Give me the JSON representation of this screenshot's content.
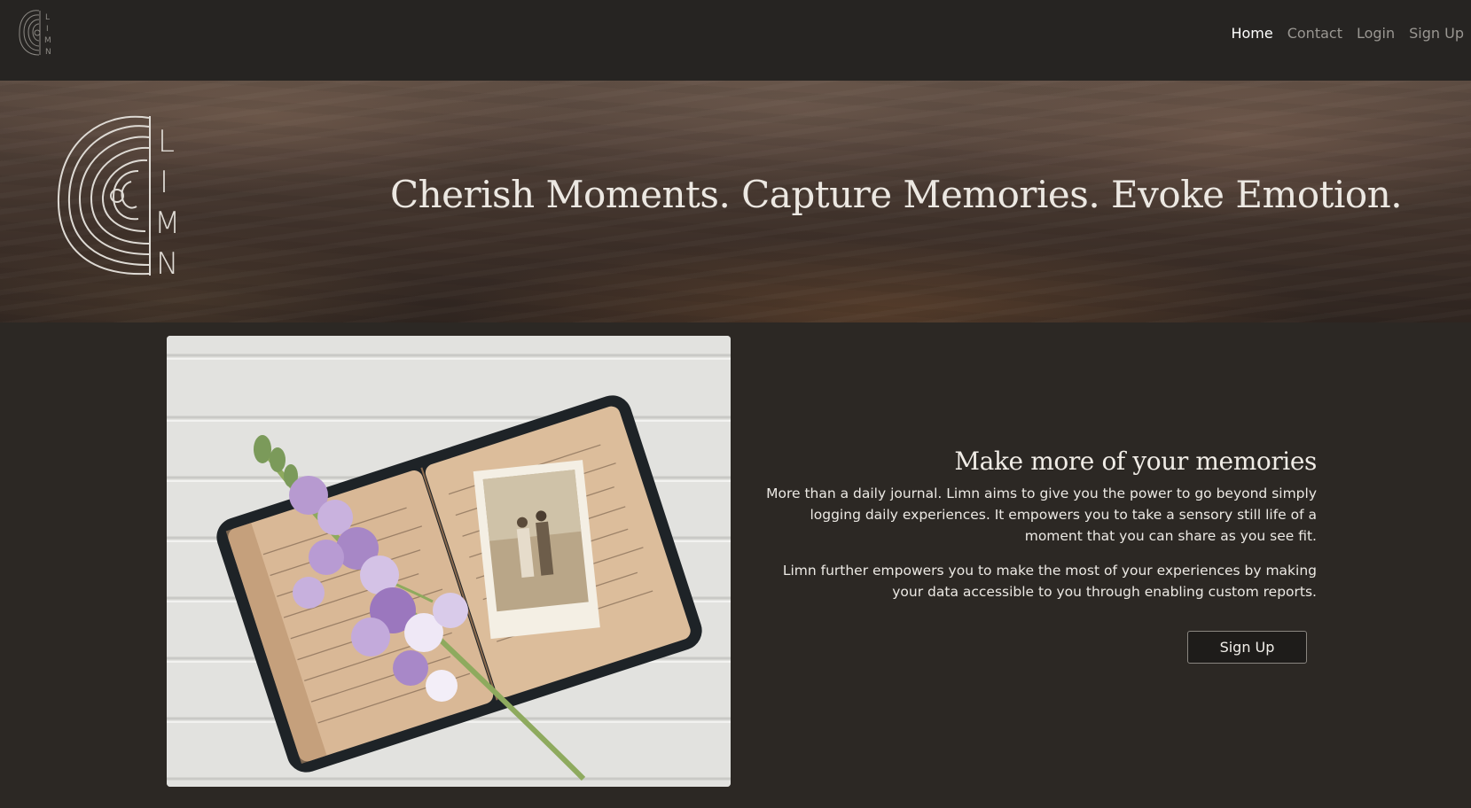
{
  "nav": {
    "logo_letters": [
      "L",
      "I",
      "M",
      "N"
    ],
    "links": [
      {
        "label": "Home",
        "active": true
      },
      {
        "label": "Contact",
        "active": false
      },
      {
        "label": "Login",
        "active": false
      },
      {
        "label": "Sign Up",
        "active": false
      }
    ]
  },
  "hero": {
    "logo_letters": [
      "L",
      "I",
      "M",
      "N"
    ],
    "tagline": "Cherish Moments. Capture Memories. Evoke Emotion."
  },
  "main": {
    "heading": "Make more of your memories",
    "paragraph1": "More than a daily journal. Limn aims to give you the power to go beyond simply logging daily experiences. It empowers you to take a sensory still life of a moment that you can share as you see fit.",
    "paragraph2": "Limn further empowers you to make the most of your experiences by making your data accessible to you through enabling custom reports.",
    "signup_label": "Sign Up"
  },
  "colors": {
    "navbar_bg": "#262422",
    "page_bg": "#2c2824",
    "text_light": "#ece9e4",
    "nav_inactive": "#9a9792"
  }
}
